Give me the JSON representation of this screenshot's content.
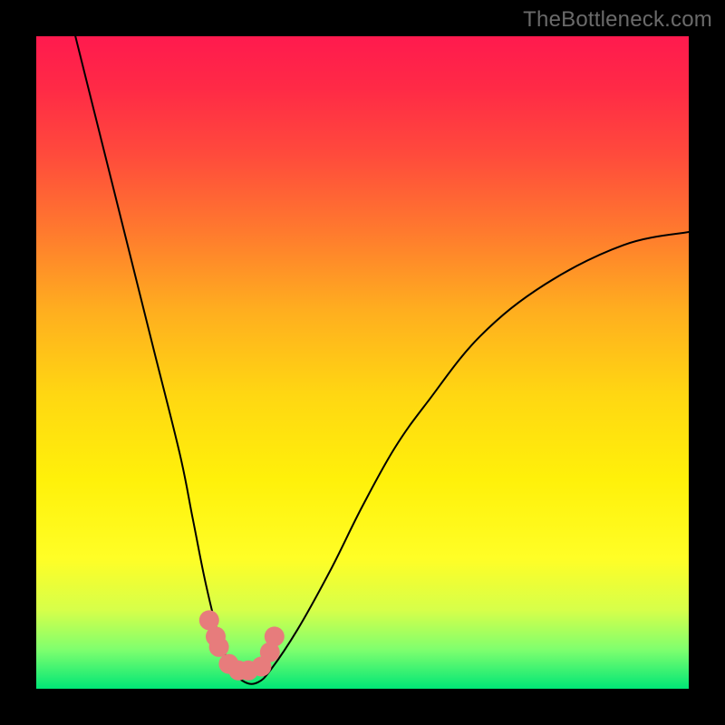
{
  "attribution": "TheBottleneck.com",
  "chart_data": {
    "type": "line",
    "title": "",
    "xlabel": "",
    "ylabel": "",
    "xlim": [
      0,
      100
    ],
    "ylim": [
      0,
      100
    ],
    "series": [
      {
        "name": "bottleneck-curve",
        "x": [
          6,
          10,
          14,
          18,
          22,
          24,
          26,
          28,
          30,
          32,
          34,
          36,
          40,
          45,
          50,
          55,
          60,
          68,
          78,
          90,
          100
        ],
        "values": [
          100,
          84,
          68,
          52,
          36,
          26,
          16,
          8,
          3,
          1,
          1,
          3,
          9,
          18,
          28,
          37,
          44,
          54,
          62,
          68,
          70
        ]
      },
      {
        "name": "highlight-dots",
        "x": [
          26.5,
          27.5,
          28.0,
          29.5,
          31.0,
          32.5,
          34.5,
          35.8,
          36.5
        ],
        "values": [
          10.5,
          8.0,
          6.4,
          3.8,
          2.8,
          2.8,
          3.4,
          5.6,
          8.0
        ]
      }
    ],
    "background_gradient_stops": [
      {
        "pos": 0,
        "color": "#ff1a4e"
      },
      {
        "pos": 8,
        "color": "#ff2a46"
      },
      {
        "pos": 18,
        "color": "#ff4a3c"
      },
      {
        "pos": 30,
        "color": "#ff7a2e"
      },
      {
        "pos": 42,
        "color": "#ffae1f"
      },
      {
        "pos": 55,
        "color": "#ffd712"
      },
      {
        "pos": 68,
        "color": "#fff10a"
      },
      {
        "pos": 80,
        "color": "#fffe26"
      },
      {
        "pos": 88,
        "color": "#d6ff4a"
      },
      {
        "pos": 94,
        "color": "#7fff6e"
      },
      {
        "pos": 100,
        "color": "#00e676"
      }
    ],
    "dot_color": "#e77c7c",
    "line_color": "#000000"
  }
}
